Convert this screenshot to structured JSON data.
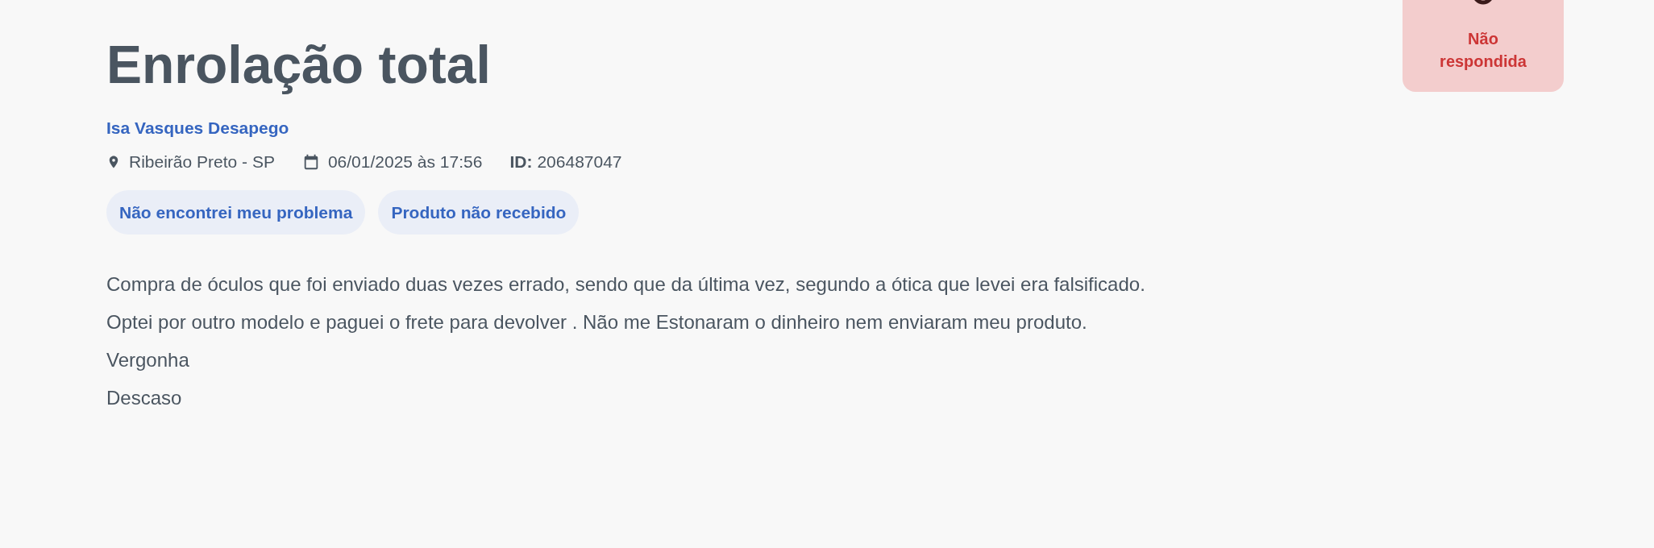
{
  "title": "Enrolação total",
  "status_badge": {
    "label": "Não respondida",
    "kind": "unanswered"
  },
  "author": "Isa Vasques Desapego",
  "meta": {
    "location": "Ribeirão Preto - SP",
    "date": "06/01/2025 às 17:56",
    "id_label": "ID:",
    "id_value": "206487047"
  },
  "tags": [
    "Não encontrei meu problema",
    "Produto não recebido"
  ],
  "body": [
    "Compra de óculos que foi enviado duas vezes errado, sendo que da última vez, segundo a ótica que levei era falsificado.",
    "Optei por outro modelo e paguei o frete para devolver . Não me Estonaram o dinheiro nem enviaram meu produto.",
    "Vergonha",
    "Descaso"
  ]
}
